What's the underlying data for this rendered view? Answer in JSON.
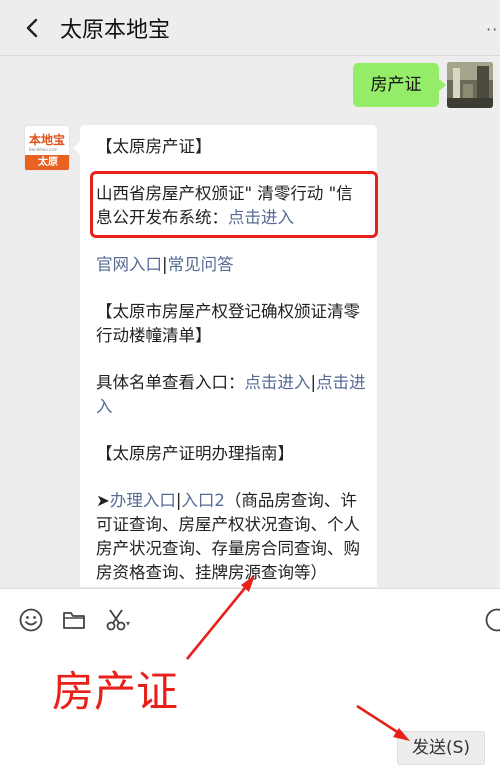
{
  "header": {
    "title": "太原本地宝",
    "back_icon": "chevron-left-icon",
    "more_icon": "more-dots-icon"
  },
  "chat": {
    "sent_message": "房产证",
    "bot_avatar": {
      "logo_top": "本地宝",
      "logo_url": "Bendibao.com",
      "logo_bottom": "太原"
    },
    "reply": {
      "heading1": "【太原房产证】",
      "system_text": "山西省房屋产权颁证\" 清零行动 \"信息公开发布系统：",
      "system_link": "点击进入",
      "official_link": "官网入口",
      "separator": "|",
      "faq_link": "常见问答",
      "heading2": "【太原市房屋产权登记确权颁证清零行动楼幢清单】",
      "list_text": "具体名单查看入口：",
      "list_link1": "点击进入",
      "list_link2": "点击进入",
      "heading3": "【太原房产证明办理指南】",
      "bullet": "➤",
      "guide_link1": "办理入口",
      "guide_link2": "入口2",
      "guide_text": "（商品房查询、许可证查询、房屋产权状况查询、个人房产状况查询、存量房合同查询、购房资格查询、挂牌房源查询等）"
    }
  },
  "toolbar": {
    "icons": [
      "emoji-icon",
      "folder-icon",
      "scissors-icon"
    ]
  },
  "annotation": {
    "text": "房产证",
    "color": "#e8201a"
  },
  "send_button": {
    "label": "发送(S)"
  },
  "colors": {
    "sent_bubble": "#95ec69",
    "link": "#576b95",
    "highlight": "#e8201a"
  }
}
